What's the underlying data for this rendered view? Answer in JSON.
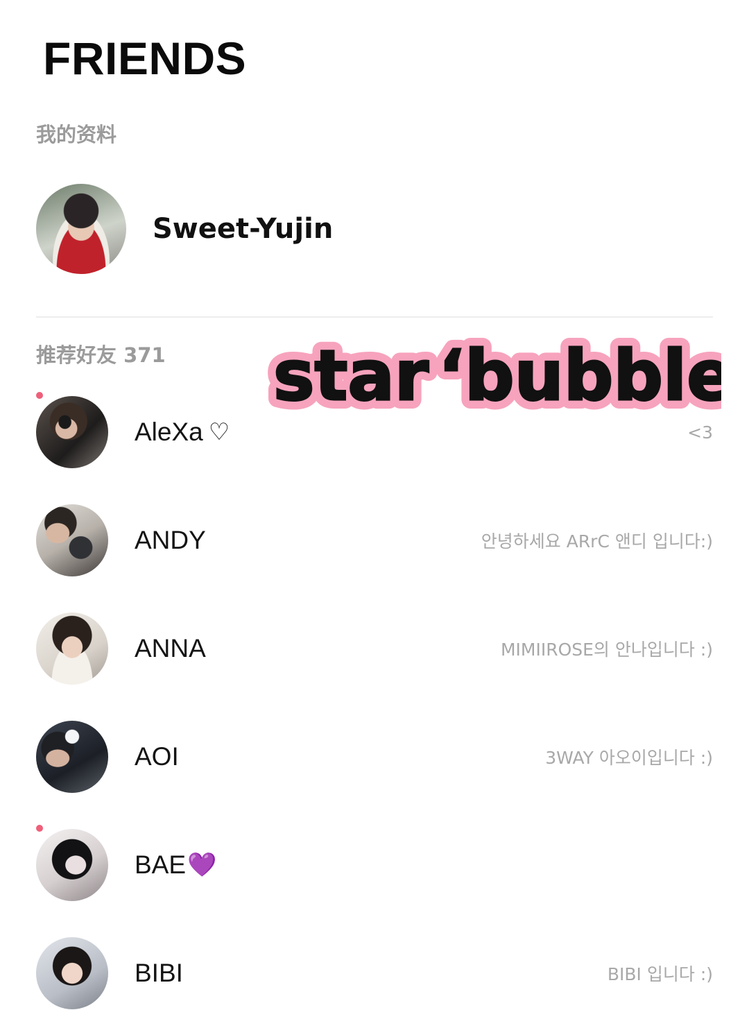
{
  "header": {
    "title": "FRIENDS"
  },
  "my_profile": {
    "section_label": "我的资料",
    "name": "Sweet-Yujin"
  },
  "friends_section": {
    "label": "推荐好友 371"
  },
  "overlay": {
    "word1": "star",
    "word2": "‘bubble"
  },
  "friends": [
    {
      "name": "AleXa",
      "emoji": "♡",
      "status": "<3",
      "has_new": true
    },
    {
      "name": "ANDY",
      "emoji": "",
      "status": "안녕하세요 ARrC 앤디 입니다:)",
      "has_new": false
    },
    {
      "name": "ANNA",
      "emoji": "",
      "status": "MIMIIROSE의 안나입니다 :)",
      "has_new": false
    },
    {
      "name": "AOI",
      "emoji": "",
      "status": "3WAY 아오이입니다 :)",
      "has_new": false
    },
    {
      "name": "BAE",
      "emoji": "💜",
      "status": "",
      "has_new": true
    },
    {
      "name": "BIBI",
      "emoji": "",
      "status": "BIBI 입니다 :)",
      "has_new": false
    }
  ],
  "colors": {
    "accent_dot": "#ef5f7a",
    "muted_text": "#a8a8a8",
    "sticker_fill": "#111111",
    "sticker_outline": "#f7a3bd"
  }
}
